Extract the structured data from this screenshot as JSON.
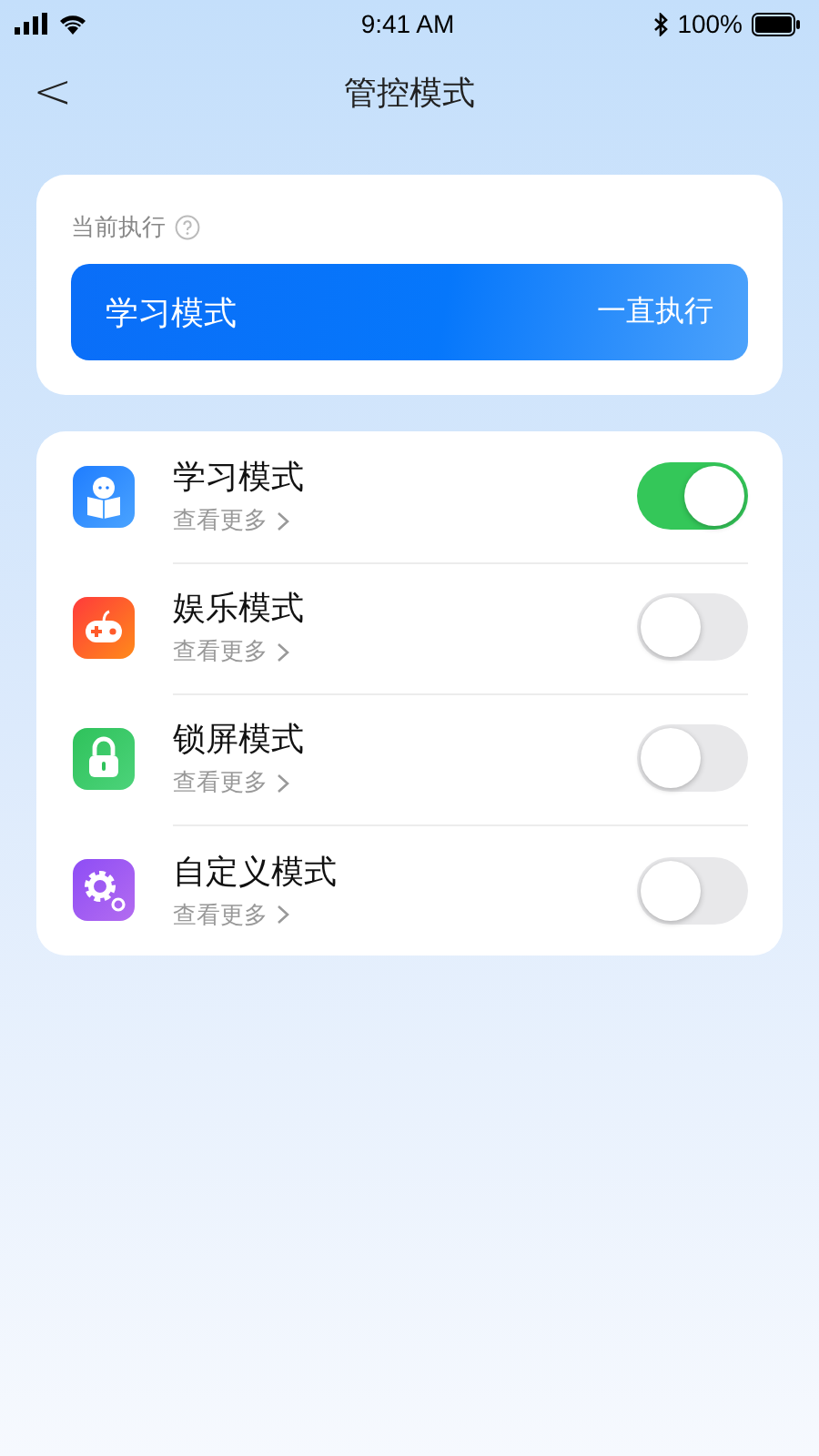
{
  "status_bar": {
    "time": "9:41 AM",
    "battery": "100%"
  },
  "nav": {
    "back": "<",
    "title": "管控模式"
  },
  "current": {
    "label": "当前执行",
    "mode": "学习模式",
    "duration": "一直执行"
  },
  "modes": [
    {
      "kind": "study",
      "name": "学习模式",
      "more": "查看更多",
      "on": true
    },
    {
      "kind": "game",
      "name": "娱乐模式",
      "more": "查看更多",
      "on": false
    },
    {
      "kind": "lock",
      "name": "锁屏模式",
      "more": "查看更多",
      "on": false
    },
    {
      "kind": "custom",
      "name": "自定义模式",
      "more": "查看更多",
      "on": false
    }
  ]
}
